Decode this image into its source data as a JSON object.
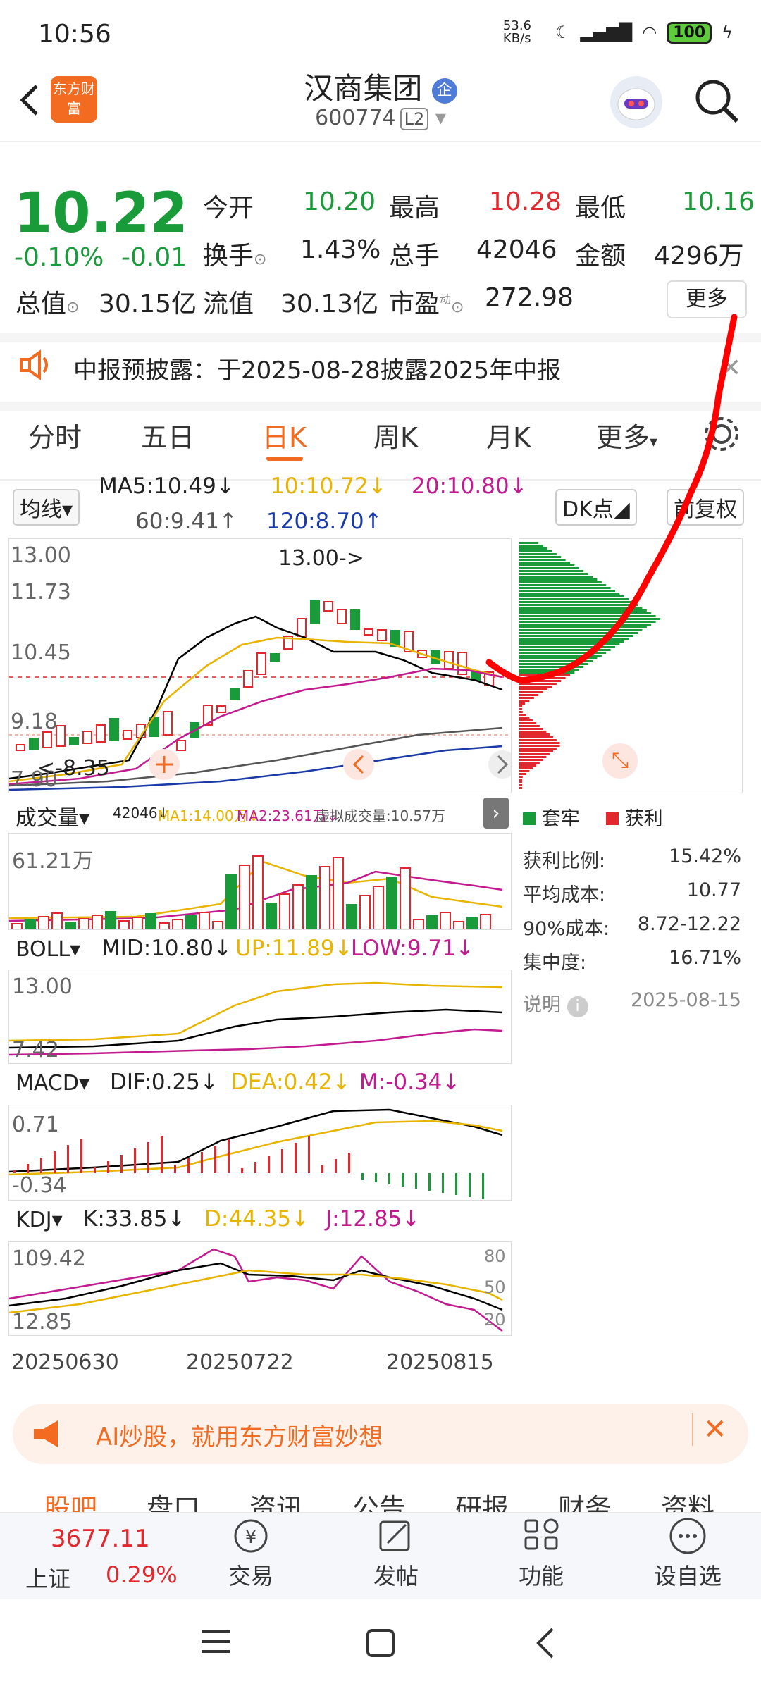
{
  "status_bar": {
    "time": "10:56",
    "net_speed": "53.6 KB/s",
    "battery": "100"
  },
  "header": {
    "back_icon": "chevron-left-icon",
    "logo_text": "东方财富",
    "stock_name": "汉商集团",
    "badge": "企",
    "stock_code": "600774",
    "level": "L2"
  },
  "quote": {
    "price": "10.22",
    "change_pct": "-0.10%",
    "change": "-0.01",
    "open_label": "今开",
    "open": "10.20",
    "high_label": "最高",
    "high": "10.28",
    "low_label": "最低",
    "low": "10.16",
    "turnover_label": "换手",
    "turnover": "1.43%",
    "volume_label": "总手",
    "volume": "42046",
    "amount_label": "金额",
    "amount": "4296万",
    "mktcap_label": "总值",
    "mktcap": "30.15亿",
    "float_label": "流值",
    "float_cap": "30.13亿",
    "pe_label": "市盈",
    "pe_sup": "动",
    "pe": "272.98",
    "more": "更多"
  },
  "notice": {
    "text": "中报预披露：于2025-08-28披露2025年中报"
  },
  "tabs": [
    "分时",
    "五日",
    "日K",
    "周K",
    "月K",
    "更多"
  ],
  "active_tab": "日K",
  "ma_bar": {
    "selector": "均线",
    "ma5": "MA5:10.49",
    "ma10": "10:10.72",
    "ma20": "20:10.80",
    "ma60": "60:9.41",
    "ma120": "120:8.70",
    "dk": "DK点",
    "fq": "前复权"
  },
  "kline": {
    "y_top": "13.00",
    "y_mid1": "11.73",
    "y_mid2": "10.45",
    "y_mid3": "9.18",
    "y_bot": "7.90",
    "high_mark": "13.00->",
    "low_mark": "<-8.35"
  },
  "volume_bar": {
    "selector": "成交量",
    "vol": "42046",
    "ma1": "MA1:14.00万",
    "ma2": "MA2:23.61万",
    "virtual": "虚拟成交量:10.57万",
    "y_top": "61.21万"
  },
  "boll_bar": {
    "selector": "BOLL",
    "mid": "MID:10.80",
    "up": "UP:11.89",
    "low": "LOW:9.71",
    "y_top": "13.00",
    "y_bot": "7.42"
  },
  "macd_bar": {
    "selector": "MACD",
    "dif": "DIF:0.25",
    "dea": "DEA:0.42",
    "m": "M:-0.34",
    "y_top": "0.71",
    "y_bot": "-0.34"
  },
  "kdj_bar": {
    "selector": "KDJ",
    "k": "K:33.85",
    "d": "D:44.35",
    "j": "J:12.85",
    "y_top": "109.42",
    "y_bot": "12.85",
    "r80": "80",
    "r50": "50",
    "r20": "20"
  },
  "dates": [
    "20250630",
    "20250722",
    "20250815"
  ],
  "chips": {
    "legend_trapped": "套牢",
    "legend_profit": "获利",
    "rows": [
      {
        "label": "获利比例:",
        "value": "15.42%"
      },
      {
        "label": "平均成本:",
        "value": "10.77"
      },
      {
        "label": "90%成本:",
        "value": "8.72-12.22"
      },
      {
        "label": "集中度:",
        "value": "16.71%"
      }
    ],
    "note": "说明",
    "date": "2025-08-15"
  },
  "ad": {
    "text": "AI炒股，就用东方财富妙想"
  },
  "bottom_tabs": [
    "股吧",
    "盘口",
    "资讯",
    "公告",
    "研报",
    "财务",
    "资料"
  ],
  "index": {
    "value": "3677.11",
    "name": "上证",
    "pct": "0.29%"
  },
  "nav": [
    "交易",
    "发帖",
    "功能",
    "设自选"
  ],
  "colors": {
    "up": "#e3282d",
    "down": "#1a9b3a",
    "accent": "#f26b21",
    "ma10": "#e8b400",
    "ma20": "#c21a8f",
    "ma120": "#1a3aa8"
  }
}
